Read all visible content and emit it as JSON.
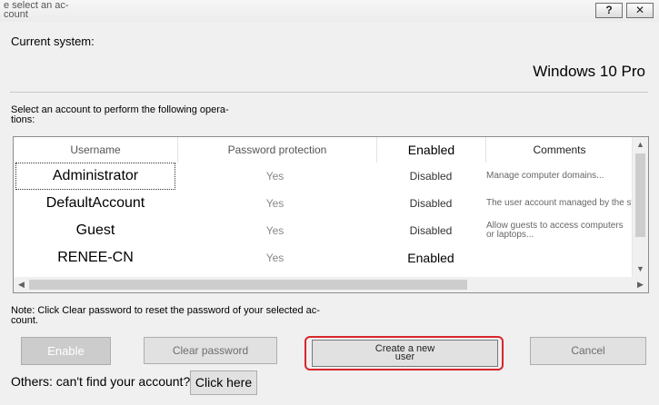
{
  "window": {
    "title": "e select an ac- count",
    "help_label": "?",
    "close_label": "X"
  },
  "system": {
    "label": "Current system:",
    "name": "Windows 10 Pro"
  },
  "instructions": {
    "line1": "Select an account to perform the following opera-",
    "line2": "tions:"
  },
  "table": {
    "columns": [
      "Username",
      "Password protection",
      "Enabled",
      "Comments"
    ],
    "rows": [
      {
        "username": "Administrator",
        "password": "Yes",
        "enabled": "Disabled",
        "comment": "Manage computer domains..."
      },
      {
        "username": "DefaultAccount",
        "password": "Yes",
        "enabled": "Disabled",
        "comment": "The user account managed by the system"
      },
      {
        "username": "Guest",
        "password": "Yes",
        "enabled": "Disabled",
        "comment": "Allow guests to access computers or laptops..."
      },
      {
        "username": "RENEE-CN",
        "password": "Yes",
        "enabled": "Enabled",
        "comment": ""
      }
    ]
  },
  "note": {
    "line1": "Note: Click Clear password to reset the password of your selected ac-",
    "line2": "count."
  },
  "buttons": {
    "enable": "Enable",
    "clear_password": "Clear password",
    "create_line1": "Create a new",
    "create_line2": "user",
    "cancel": "Cancel"
  },
  "others": {
    "label": "Others: can't find your account?",
    "click_here": "Click here"
  },
  "colors": {
    "highlight": "#d9262c",
    "background": "#f0f0f0"
  }
}
